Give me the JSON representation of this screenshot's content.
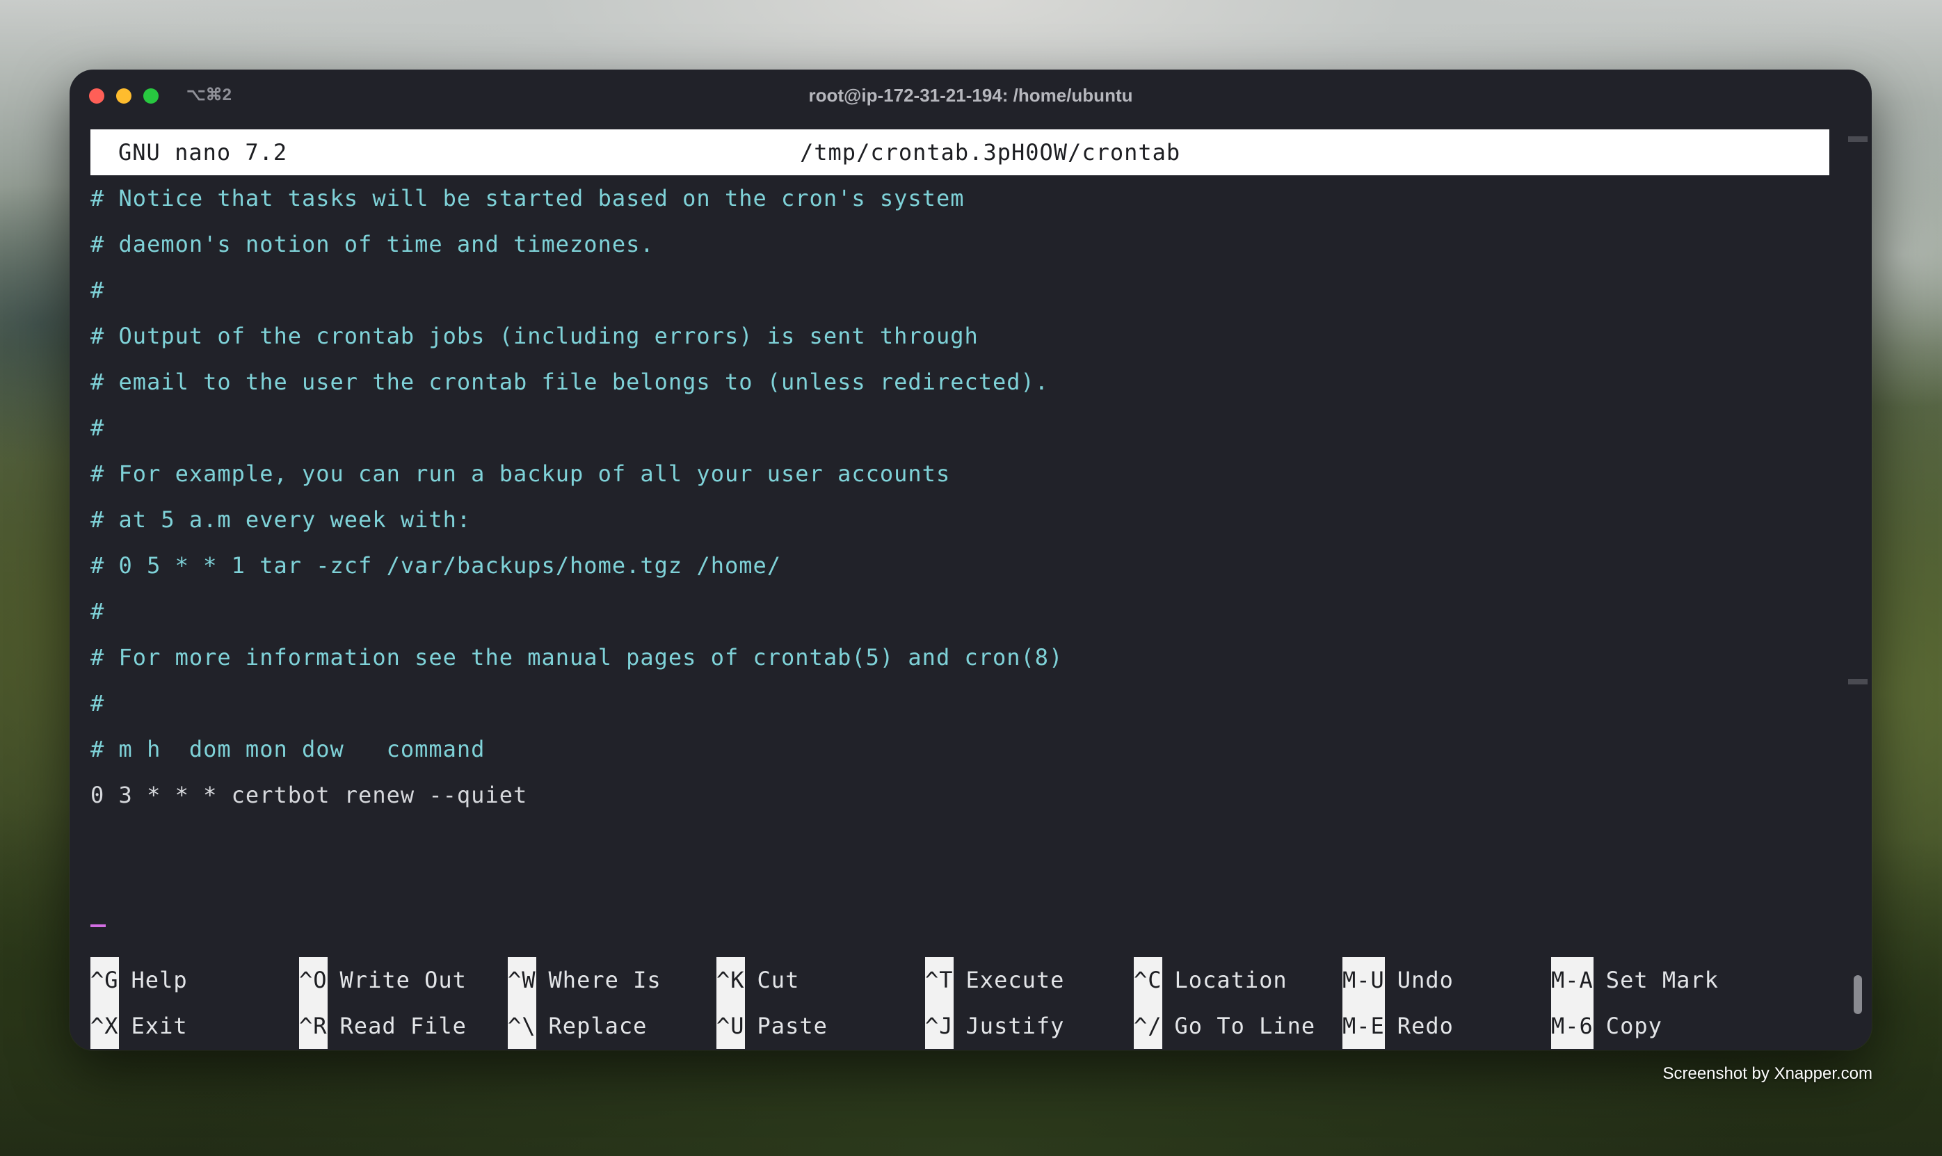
{
  "window": {
    "shortcut": "⌥⌘2",
    "title": "root@ip-172-31-21-194: /home/ubuntu"
  },
  "nano": {
    "version": "GNU nano 7.2",
    "file_path": "/tmp/crontab.3pH0OW/crontab"
  },
  "buffer_lines": [
    "# Notice that tasks will be started based on the cron's system",
    "# daemon's notion of time and timezones.",
    "#",
    "# Output of the crontab jobs (including errors) is sent through",
    "# email to the user the crontab file belongs to (unless redirected).",
    "#",
    "# For example, you can run a backup of all your user accounts",
    "# at 5 a.m every week with:",
    "# 0 5 * * 1 tar -zcf /var/backups/home.tgz /home/",
    "#",
    "# For more information see the manual pages of crontab(5) and cron(8)",
    "#",
    "# m h  dom mon dow   command",
    "0 3 * * * certbot renew --quiet"
  ],
  "shortcuts_row1": [
    {
      "key": "^G",
      "label": "Help"
    },
    {
      "key": "^O",
      "label": "Write Out"
    },
    {
      "key": "^W",
      "label": "Where Is"
    },
    {
      "key": "^K",
      "label": "Cut"
    },
    {
      "key": "^T",
      "label": "Execute"
    },
    {
      "key": "^C",
      "label": "Location"
    },
    {
      "key": "M-U",
      "label": "Undo"
    },
    {
      "key": "M-A",
      "label": "Set Mark"
    }
  ],
  "shortcuts_row2": [
    {
      "key": "^X",
      "label": "Exit"
    },
    {
      "key": "^R",
      "label": "Read File"
    },
    {
      "key": "^\\",
      "label": "Replace"
    },
    {
      "key": "^U",
      "label": "Paste"
    },
    {
      "key": "^J",
      "label": "Justify"
    },
    {
      "key": "^/",
      "label": "Go To Line"
    },
    {
      "key": "M-E",
      "label": "Redo"
    },
    {
      "key": "M-6",
      "label": "Copy"
    }
  ],
  "watermark": "Screenshot by Xnapper.com",
  "colors": {
    "comment": "#7fd2d8",
    "cursor": "#d36ee3",
    "terminal_bg": "#212229"
  }
}
